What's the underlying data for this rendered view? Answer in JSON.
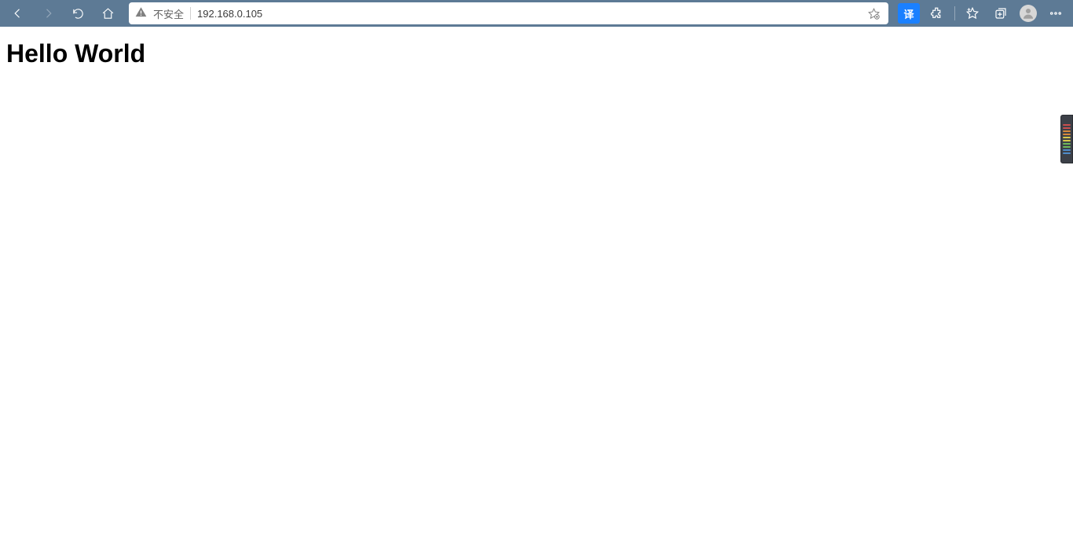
{
  "toolbar": {
    "security_label": "不安全",
    "url": "192.168.0.105",
    "translate_label": "译"
  },
  "page": {
    "heading": "Hello World"
  }
}
